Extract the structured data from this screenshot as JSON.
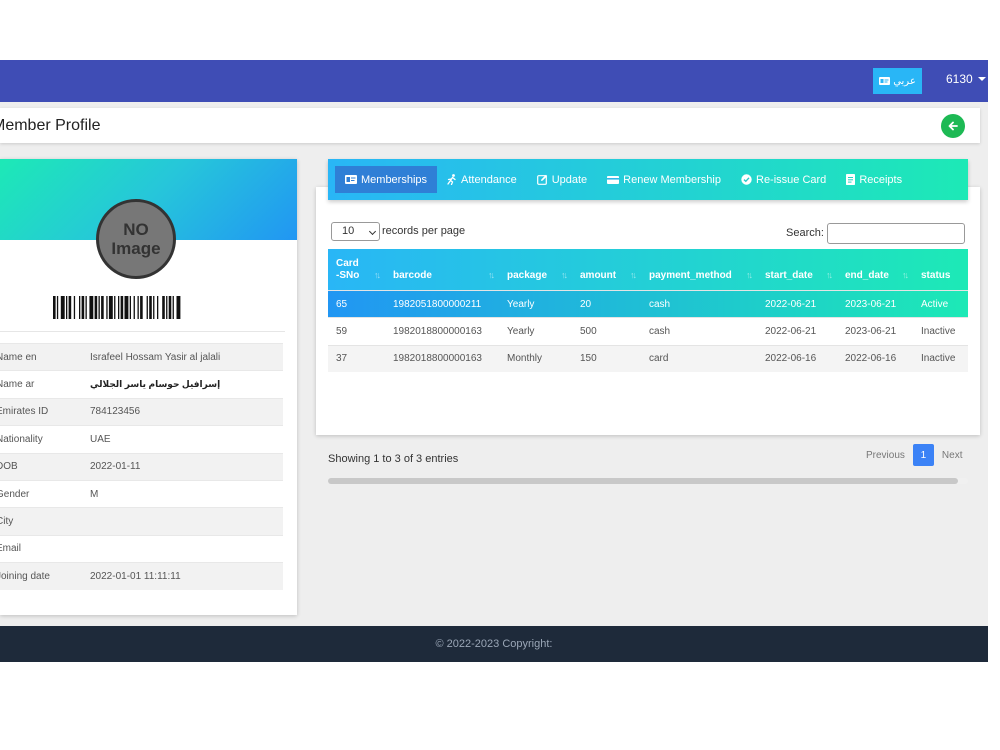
{
  "colors": {
    "navbar": "#3f4db5",
    "accent_gradient_start": "#29b6f6",
    "accent_gradient_end": "#1de9b6",
    "active_tab": "#2f7fd6",
    "back_button": "#1db954",
    "footer": "#1e2a3a",
    "page_button": "#3b82f6"
  },
  "topnav": {
    "language_label": "عربي",
    "language_icon": "id-card-icon",
    "user_label": "6130"
  },
  "header": {
    "title": "Member Profile",
    "back_icon": "arrow-left-icon"
  },
  "profile": {
    "avatar_line1": "NO",
    "avatar_line2": "Image",
    "fields": [
      {
        "label": "Name en",
        "value": "Israfeel Hossam Yasir al jalali"
      },
      {
        "label": "Name ar",
        "value": "إسرافيل حوسام ياسر الجلالي"
      },
      {
        "label": "Emirates ID",
        "value": "784123456"
      },
      {
        "label": "Nationality",
        "value": "UAE"
      },
      {
        "label": "DOB",
        "value": "2022-01-11"
      },
      {
        "label": "Gender",
        "value": "M"
      },
      {
        "label": "City",
        "value": ""
      },
      {
        "label": "Email",
        "value": ""
      },
      {
        "label": "Joining date",
        "value": "2022-01-01 11:11:11"
      }
    ]
  },
  "tabs": [
    {
      "label": "Memberships",
      "icon": "id-card-icon",
      "active": true
    },
    {
      "label": "Attendance",
      "icon": "running-icon",
      "active": false
    },
    {
      "label": "Update",
      "icon": "edit-icon",
      "active": false
    },
    {
      "label": "Renew Membership",
      "icon": "credit-card-icon",
      "active": false
    },
    {
      "label": "Re-issue Card",
      "icon": "check-circle-icon",
      "active": false
    },
    {
      "label": "Receipts",
      "icon": "receipt-icon",
      "active": false
    }
  ],
  "table_controls": {
    "length_value": "10",
    "length_label": "records per page",
    "search_label": "Search:",
    "search_value": ""
  },
  "memberships": {
    "columns": [
      "Card-SNo",
      "barcode",
      "package",
      "amount",
      "payment_method",
      "start_date",
      "end_date",
      "status"
    ],
    "rows": [
      [
        "65",
        "1982051800000211",
        "Yearly",
        "20",
        "cash",
        "2022-06-21",
        "2023-06-21",
        "Active"
      ],
      [
        "59",
        "1982018800000163",
        "Yearly",
        "500",
        "cash",
        "2022-06-21",
        "2023-06-21",
        "Inactive"
      ],
      [
        "37",
        "1982018800000163",
        "Monthly",
        "150",
        "card",
        "2022-06-16",
        "2022-06-16",
        "Inactive"
      ]
    ],
    "selected_row": 0
  },
  "pagination": {
    "info": "Showing 1 to 3 of 3 entries",
    "previous": "Previous",
    "current_page": "1",
    "next": "Next"
  },
  "footer": {
    "text": "© 2022-2023 Copyright:"
  }
}
